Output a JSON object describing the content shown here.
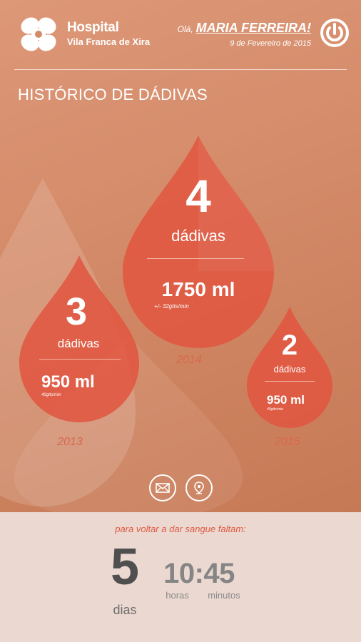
{
  "header": {
    "logo_title": "Hospital",
    "logo_subtitle": "Vila Franca de Xira",
    "greeting": "Olá,",
    "user_name": "MARIA FERREIRA!",
    "date": "9 de Fevereiro de 2015",
    "power_icon": "power-icon"
  },
  "page_title": "HISTÓRICO DE DÁDIVAS",
  "donations": [
    {
      "year": "2013",
      "count": "3",
      "count_label": "dádivas",
      "volume": "950 ml",
      "rate": "40gtts/min"
    },
    {
      "year": "2014",
      "count": "4",
      "count_label": "dádivas",
      "volume": "1750 ml",
      "rate": "+/- 32gtts/min"
    },
    {
      "year": "2015",
      "count": "2",
      "count_label": "dádivas",
      "volume": "950 ml",
      "rate": "40gtts/min"
    }
  ],
  "actions": {
    "mail_icon": "mail-icon",
    "location_icon": "location-pin-icon"
  },
  "countdown": {
    "label": "para voltar a dar sangue faltam:",
    "days": "5",
    "days_label": "dias",
    "time": "10:45",
    "hours_label": "horas",
    "minutes_label": "minutos"
  },
  "colors": {
    "background_top": "#d38a68",
    "drop": "#e2553f",
    "year_text": "#d9684f",
    "countdown_label": "#de5a43",
    "bottom_panel": "#ebd8d0"
  }
}
